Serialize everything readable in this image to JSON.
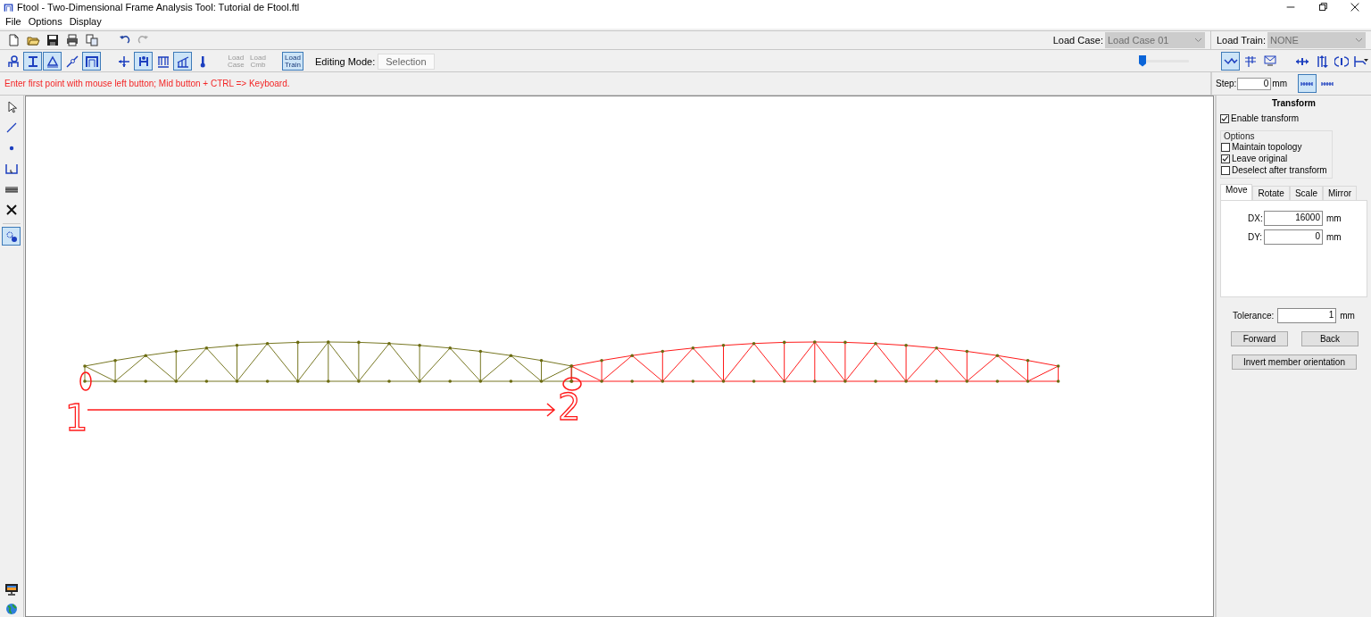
{
  "window": {
    "title": "Ftool - Two-Dimensional Frame Analysis Tool: Tutorial de Ftool.ftl"
  },
  "menu": [
    "File",
    "Options",
    "Display"
  ],
  "file_toolbar": [
    {
      "kind": "new"
    },
    {
      "kind": "open"
    },
    {
      "kind": "save"
    },
    {
      "kind": "print"
    },
    {
      "kind": "copy"
    },
    {
      "kind": "gap"
    },
    {
      "kind": "undo"
    },
    {
      "kind": "redo",
      "disabled": true
    }
  ],
  "load_case": {
    "label": "Load Case:",
    "value": "Load Case 01",
    "disabled": true
  },
  "load_train": {
    "label": "Load Train:",
    "value": "NONE",
    "disabled": true
  },
  "mode_toolbar": [
    {
      "kind": "support",
      "selected": false
    },
    {
      "kind": "section",
      "selected": true
    },
    {
      "kind": "material",
      "selected": true
    },
    {
      "kind": "hinge",
      "selected": false
    },
    {
      "kind": "frame",
      "selected": true
    },
    {
      "kind": "gap"
    },
    {
      "kind": "nodal",
      "selected": false
    },
    {
      "kind": "forces",
      "selected": true
    },
    {
      "kind": "uniform",
      "selected": false
    },
    {
      "kind": "linear",
      "selected": true
    },
    {
      "kind": "thermal",
      "selected": false
    },
    {
      "kind": "gap"
    },
    {
      "kind": "text",
      "label": "Load Case",
      "selected": false,
      "disabled": true
    },
    {
      "kind": "text",
      "label": "Load Cmb",
      "selected": false,
      "disabled": true
    },
    {
      "kind": "gap"
    },
    {
      "kind": "text",
      "label": "Load Train",
      "selected": true,
      "disabled": false
    }
  ],
  "editing_mode": {
    "label": "Editing Mode:",
    "value": "Selection"
  },
  "zoom_slider": {
    "level": 0
  },
  "view_toolbar": [
    {
      "kind": "zigzag",
      "selected": true
    },
    {
      "kind": "grid",
      "selected": false
    },
    {
      "kind": "envelope",
      "selected": false
    },
    {
      "kind": "gap"
    },
    {
      "kind": "harrows",
      "selected": false
    },
    {
      "kind": "varrows",
      "selected": false
    },
    {
      "kind": "rotate",
      "selected": false
    },
    {
      "kind": "dropdown",
      "selected": false
    }
  ],
  "status_message": "Enter first point with mouse left button; Mid button + CTRL => Keyboard.",
  "step": {
    "label": "Step:",
    "value": "0",
    "unit": "mm",
    "snap": [
      {
        "selected": true
      },
      {
        "selected": false
      }
    ]
  },
  "left_tools": [
    {
      "kind": "cursor",
      "selected": false
    },
    {
      "kind": "line",
      "selected": false
    },
    {
      "kind": "dot",
      "selected": false
    },
    {
      "kind": "dimension",
      "selected": false
    },
    {
      "kind": "hatch",
      "selected": false
    },
    {
      "kind": "delete",
      "selected": false
    },
    {
      "kind": "separator"
    },
    {
      "kind": "transform",
      "selected": true
    }
  ],
  "bottom_tools": [
    {
      "kind": "monitor"
    },
    {
      "kind": "globe"
    }
  ],
  "canvas": {
    "trusses": [
      {
        "selected": false
      },
      {
        "selected": true
      }
    ],
    "annotations": [
      {
        "kind": "circle"
      },
      {
        "kind": "circle"
      },
      {
        "kind": "arrow"
      },
      {
        "kind": "number",
        "text": "1"
      },
      {
        "kind": "number",
        "text": "2"
      }
    ]
  },
  "transform_panel": {
    "title": "Transform",
    "enable": {
      "label": "Enable transform",
      "checked": true
    },
    "options_title": "Options",
    "options": [
      {
        "label": "Maintain topology",
        "checked": false
      },
      {
        "label": "Leave original",
        "checked": true
      },
      {
        "label": "Deselect after transform",
        "checked": false
      }
    ],
    "tabs": [
      {
        "label": "Move",
        "selected": true
      },
      {
        "label": "Rotate",
        "selected": false
      },
      {
        "label": "Scale",
        "selected": false
      },
      {
        "label": "Mirror",
        "selected": false
      }
    ],
    "fields": [
      {
        "label": "DX:",
        "value": "16000",
        "unit": "mm"
      },
      {
        "label": "DY:",
        "value": "0",
        "unit": "mm"
      }
    ],
    "tolerance": {
      "label": "Tolerance:",
      "value": "1",
      "unit": "mm"
    },
    "buttons": [
      "Forward",
      "Back"
    ],
    "invert_button": "Invert member orientation"
  }
}
